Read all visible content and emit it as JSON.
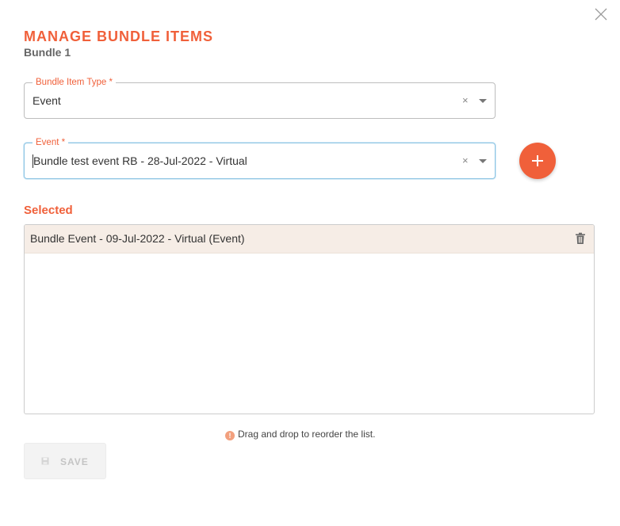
{
  "dialog": {
    "title": "MANAGE BUNDLE ITEMS",
    "subtitle": "Bundle 1",
    "accent_color": "#f0603a"
  },
  "form": {
    "bundle_item_type": {
      "label": "Bundle Item Type *",
      "value": "Event"
    },
    "event": {
      "label": "Event *",
      "value": "Bundle test event RB - 28-Jul-2022 - Virtual"
    },
    "clear_glyph": "×"
  },
  "selected": {
    "title": "Selected",
    "items": [
      {
        "label": "Bundle Event - 09-Jul-2022 - Virtual (Event)"
      }
    ]
  },
  "hint": {
    "icon": "info-icon",
    "icon_glyph": "!",
    "text": "Drag and drop to reorder the list."
  },
  "actions": {
    "save_label": "SAVE",
    "save_disabled": true
  },
  "icons": [
    "close-icon",
    "clear-icon",
    "chevron-down-icon",
    "plus-icon",
    "trash-icon",
    "info-icon",
    "save-icon"
  ]
}
